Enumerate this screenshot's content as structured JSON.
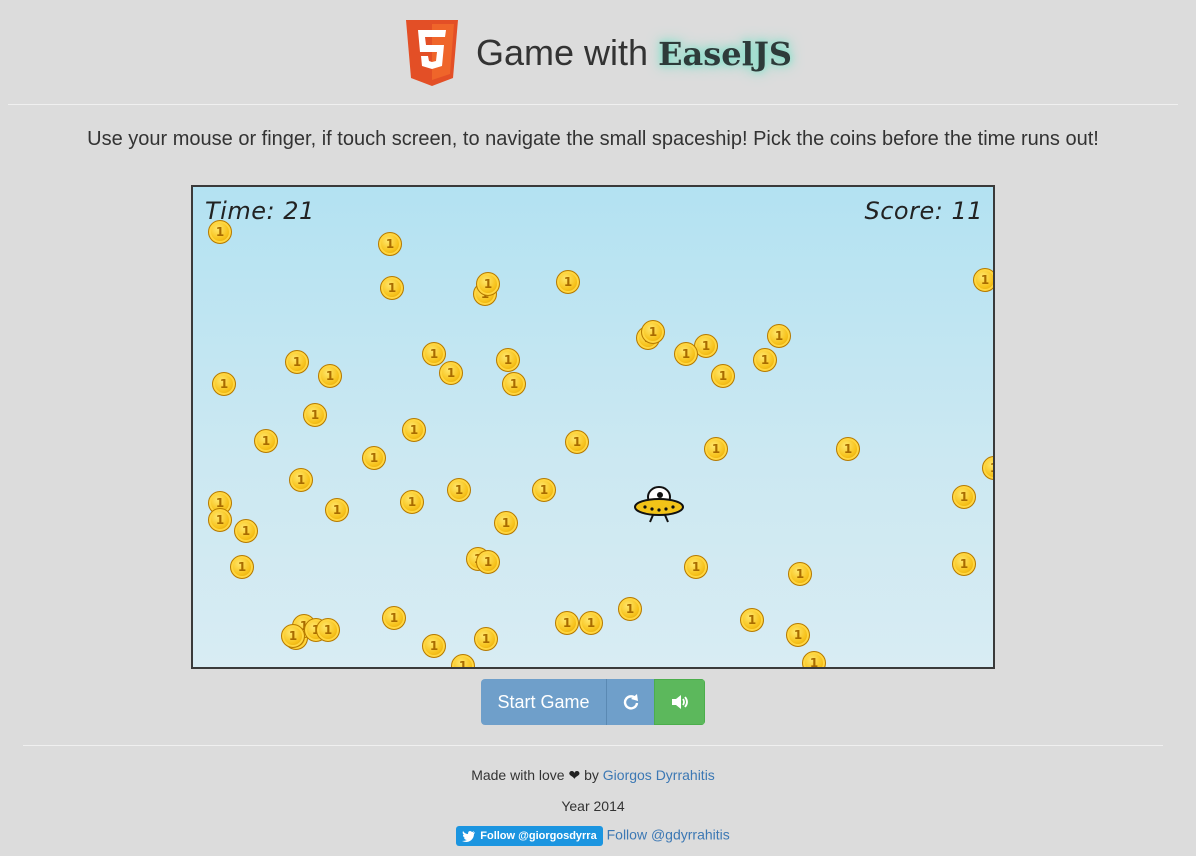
{
  "header": {
    "title_prefix": "Game with",
    "title_brand": "EaselJS",
    "logo_icon": "html5-logo"
  },
  "instructions": "Use your mouse or finger, if touch screen, to navigate the small spaceship! Pick the coins before the time runs out!",
  "hud": {
    "time_label": "Time: 21",
    "score_label": "Score: 11"
  },
  "coin_glyph": "1",
  "controls": {
    "start_label": "Start Game",
    "reset_icon": "refresh-icon",
    "sound_icon": "volume-icon"
  },
  "footer": {
    "made_with": "Made with love",
    "by": "by",
    "author": "Giorgos Dyrrahitis",
    "year": "Year 2014",
    "twitter_button": "Follow @giorgosdyrra",
    "follow_link": "Follow @gdyrrahitis"
  },
  "colors": {
    "primary_button": "#6f9fca",
    "success_button": "#5cb85c",
    "link": "#3c78b4",
    "twitter": "#1b95e0"
  }
}
